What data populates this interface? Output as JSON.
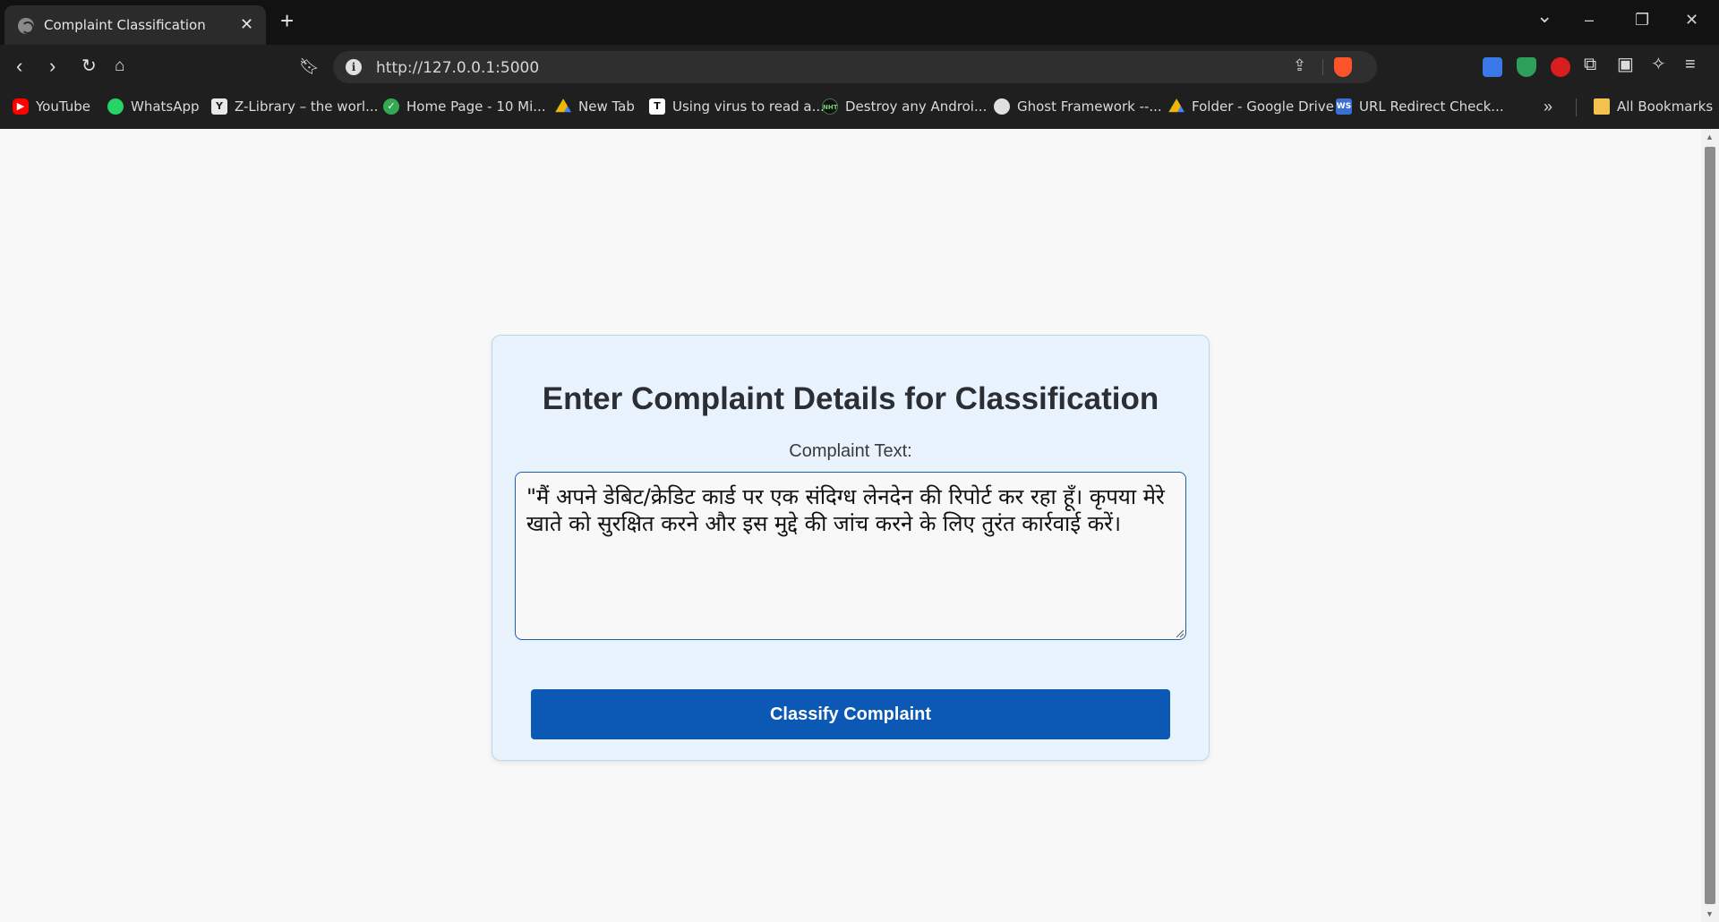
{
  "browser": {
    "tab_title": "Complaint Classification",
    "tab_close": "✕",
    "new_tab": "+",
    "url": "http://127.0.0.1:5000",
    "window_controls": {
      "menu": "⌄",
      "minimize": "–",
      "restore": "❐",
      "close": "✕"
    },
    "bookmarks": [
      {
        "label": "YouTube",
        "icon": "youtube-icon",
        "color": "#ff0000"
      },
      {
        "label": "WhatsApp",
        "icon": "whatsapp-icon",
        "color": "#25d366"
      },
      {
        "label": "Z-Library – the worl...",
        "icon": "zlibrary-icon",
        "color": "#e8e8e8"
      },
      {
        "label": "Home Page - 10 Mi...",
        "icon": "check-icon",
        "color": "#34a853"
      },
      {
        "label": "New Tab",
        "icon": "google-drive-icon",
        "color": "#f4b400"
      },
      {
        "label": "Using virus to read a...",
        "icon": "t-icon",
        "color": "#ffffff"
      },
      {
        "label": "Destroy any Androi...",
        "icon": "nht-icon",
        "color": "#111111"
      },
      {
        "label": "Ghost Framework --...",
        "icon": "ghost-icon",
        "color": "#e0e0e0"
      },
      {
        "label": "Folder - Google Drive",
        "icon": "google-drive-icon",
        "color": "#f4b400"
      },
      {
        "label": "URL Redirect Check...",
        "icon": "ws-icon",
        "color": "#3b6fd4"
      }
    ],
    "all_bookmarks": "All Bookmarks",
    "more_bookmarks": "»"
  },
  "page": {
    "title": "Enter Complaint Details for Classification",
    "field_label": "Complaint Text:",
    "complaint_value": "\"मैं अपने डेबिट/क्रेडिट कार्ड पर एक संदिग्ध लेनदेन की रिपोर्ट कर रहा हूँ। कृपया मेरे खाते को सुरक्षित करने और इस मुद्दे की जांच करने के लिए तुरंत कार्रवाई करें।",
    "button_label": "Classify Complaint"
  },
  "colors": {
    "card_bg": "#e9f3fd",
    "button_bg": "#0b58b5",
    "textarea_border": "#1f5fa8"
  }
}
